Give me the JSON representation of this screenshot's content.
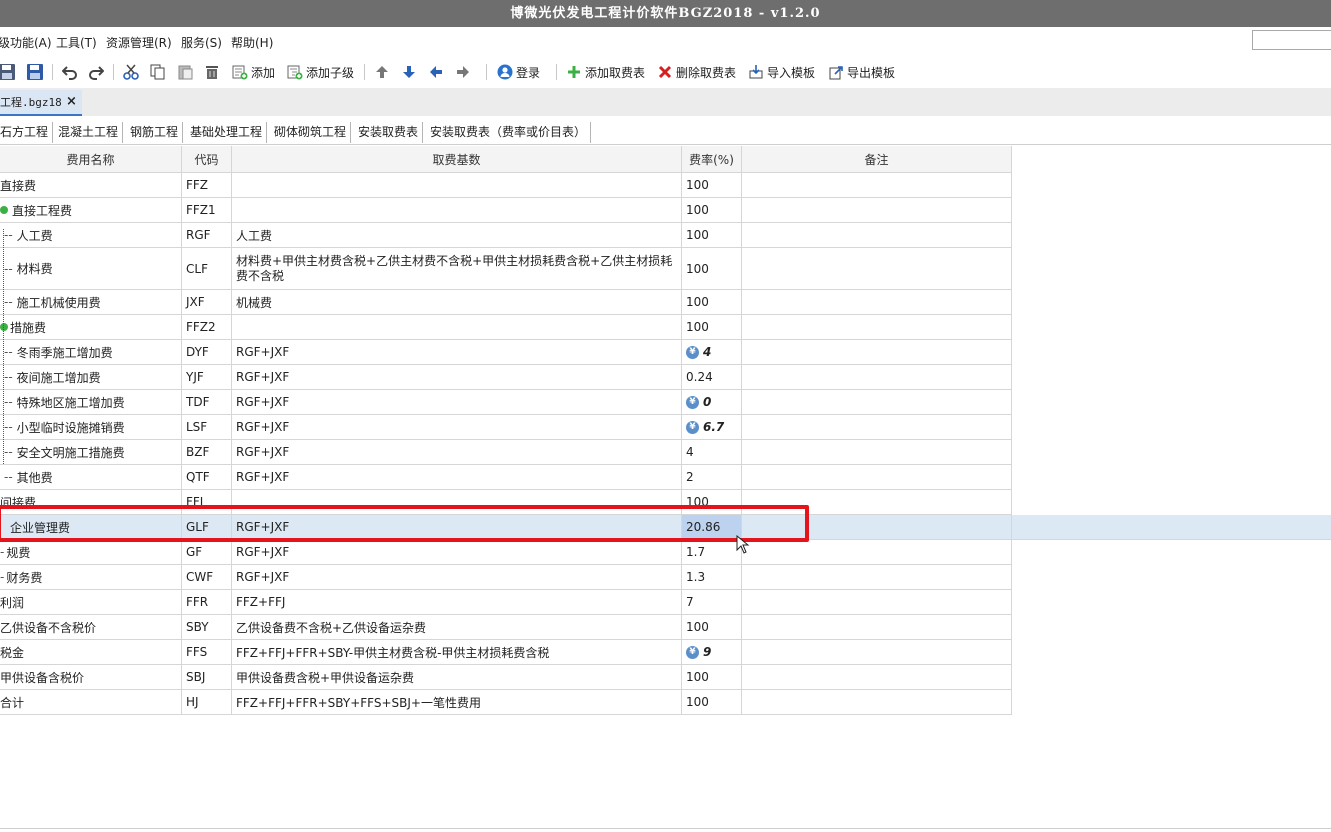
{
  "title": "博微光伏发电工程计价软件BGZ2018 - v1.2.0",
  "menu": [
    "级功能(A)",
    "工具(T)",
    "资源管理(R)",
    "服务(S)",
    "帮助(H)"
  ],
  "toolbar": {
    "add": "添加",
    "add_child": "添加子级",
    "login": "登录",
    "add_fee_table": "添加取费表",
    "delete_fee_table": "删除取费表",
    "import_template": "导入模板",
    "export_template": "导出模板"
  },
  "doc_tab": {
    "label": "工程.bgz18",
    "close": "×"
  },
  "sheet_tabs": [
    "石方工程",
    "混凝土工程",
    "钢筋工程",
    "基础处理工程",
    "砌体砌筑工程",
    "安装取费表",
    "安装取费表（费率或价目表）"
  ],
  "table": {
    "headers": {
      "name": "费用名称",
      "code": "代码",
      "base": "取费基数",
      "rate": "费率(%)",
      "note": "备注"
    },
    "rows": [
      {
        "name": "直接费",
        "code": "FFZ",
        "base": "",
        "rate": "100"
      },
      {
        "name": "直接工程费",
        "code": "FFZ1",
        "base": "",
        "rate": "100"
      },
      {
        "name": "人工费",
        "code": "RGF",
        "base": "人工费",
        "rate": "100"
      },
      {
        "name": "材料费",
        "code": "CLF",
        "base": "材料费+甲供主材费含税+乙供主材费不含税+甲供主材损耗费含税+乙供主材损耗费不含税",
        "rate": "100"
      },
      {
        "name": "施工机械使用费",
        "code": "JXF",
        "base": "机械费",
        "rate": "100"
      },
      {
        "name": "措施费",
        "code": "FFZ2",
        "base": "",
        "rate": "100"
      },
      {
        "name": "冬雨季施工增加费",
        "code": "DYF",
        "base": "RGF+JXF",
        "rate": "4"
      },
      {
        "name": "夜间施工增加费",
        "code": "YJF",
        "base": "RGF+JXF",
        "rate": "0.24"
      },
      {
        "name": "特殊地区施工增加费",
        "code": "TDF",
        "base": "RGF+JXF",
        "rate": "0"
      },
      {
        "name": "小型临时设施摊销费",
        "code": "LSF",
        "base": "RGF+JXF",
        "rate": "6.7"
      },
      {
        "name": "安全文明施工措施费",
        "code": "BZF",
        "base": "RGF+JXF",
        "rate": "4"
      },
      {
        "name": "其他费",
        "code": "QTF",
        "base": "RGF+JXF",
        "rate": "2"
      },
      {
        "name": "间接费",
        "code": "FFJ",
        "base": "",
        "rate": "100"
      },
      {
        "name": "企业管理费",
        "code": "GLF",
        "base": "RGF+JXF",
        "rate": "20.86"
      },
      {
        "name": "规费",
        "code": "GF",
        "base": "RGF+JXF",
        "rate": "1.7"
      },
      {
        "name": "财务费",
        "code": "CWF",
        "base": "RGF+JXF",
        "rate": "1.3"
      },
      {
        "name": "利润",
        "code": "FFR",
        "base": "FFZ+FFJ",
        "rate": "7"
      },
      {
        "name": "乙供设备不含税价",
        "code": "SBY",
        "base": "乙供设备费不含税+乙供设备运杂费",
        "rate": "100"
      },
      {
        "name": "税金",
        "code": "FFS",
        "base": "FFZ+FFJ+FFR+SBY-甲供主材费含税-甲供主材损耗费含税",
        "rate": "9"
      },
      {
        "name": "甲供设备含税价",
        "code": "SBJ",
        "base": "甲供设备费含税+甲供设备运杂费",
        "rate": "100"
      },
      {
        "name": "合计",
        "code": "HJ",
        "base": "FFZ+FFJ+FFR+SBY+FFS+SBJ+一笔性费用",
        "rate": "100"
      }
    ]
  },
  "colors": {
    "highlight": "#e3141b",
    "selected_row": "#dde8f5",
    "titlebar": "#6e6e6e"
  }
}
